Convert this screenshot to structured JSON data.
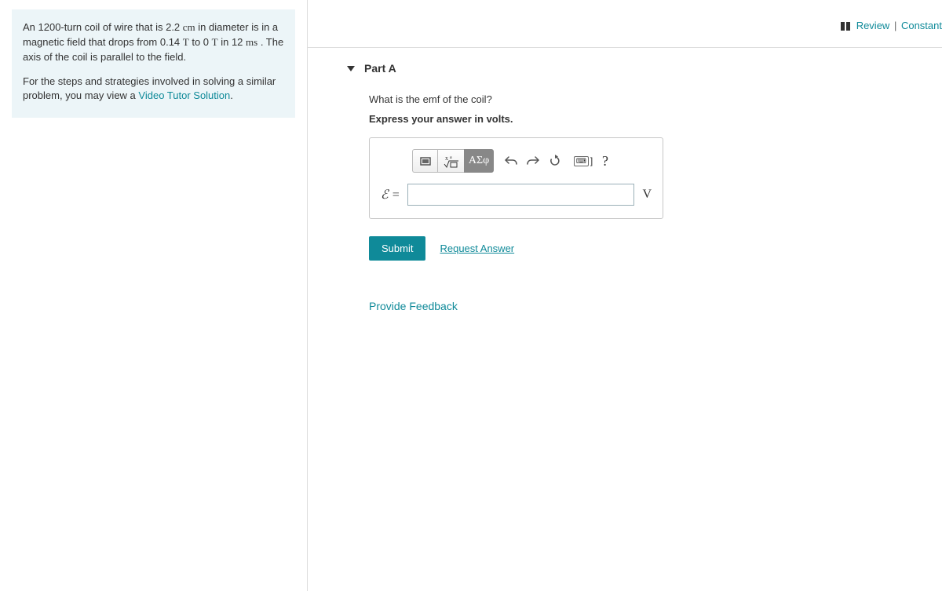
{
  "topnav": {
    "review": "Review",
    "constants": "Constant"
  },
  "problem": {
    "p1_pre": "An 1200-turn coil of wire that is 2.2 ",
    "p1_cm": "cm",
    "p1_mid1": " in diameter is in a magnetic field that drops from 0.14 ",
    "p1_T1": "T",
    "p1_mid2": " to 0 ",
    "p1_T2": "T",
    "p1_mid3": " in 12 ",
    "p1_ms": "ms",
    "p1_end": " . The axis of the coil is parallel to the field.",
    "p2_pre": "For the steps and strategies involved in solving a similar problem, you may view a ",
    "video_link": "Video Tutor Solution",
    "p2_end": "."
  },
  "part": {
    "label": "Part A"
  },
  "question": {
    "text": "What is the emf of the coil?",
    "instruction": "Express your answer in volts."
  },
  "input": {
    "var": "ℰ =",
    "value": "",
    "unit": "V",
    "greek": "ΑΣφ",
    "help": "?",
    "bracket": "]"
  },
  "actions": {
    "submit": "Submit",
    "request": "Request Answer",
    "feedback": "Provide Feedback"
  }
}
